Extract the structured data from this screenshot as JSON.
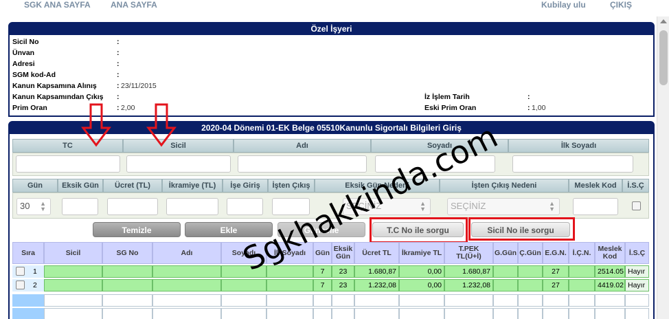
{
  "topnav": {
    "home_sgk": "SGK ANA SAYFA",
    "home": "ANA SAYFA",
    "user": "Kubilay ulu",
    "logout": "ÇIKIŞ"
  },
  "employer": {
    "title": "Özel İşyeri",
    "fields": [
      {
        "label": "Sicil No",
        "value": ""
      },
      {
        "label": "Ünvan",
        "value": ""
      },
      {
        "label": "Adresi",
        "value": ""
      },
      {
        "label": "SGM kod-Ad",
        "value": ""
      },
      {
        "label": "Kanun Kapsamına Alınış",
        "value": "23/11/2015"
      },
      {
        "label": "Kanun Kapsamından Çıkış",
        "value": ""
      },
      {
        "label": "Prim Oran",
        "value": "2,00"
      }
    ],
    "right_fields": [
      {
        "label": "İz İşlem Tarih",
        "value": ""
      },
      {
        "label": "Eski Prim Oran",
        "value": "1,00"
      }
    ]
  },
  "insured": {
    "title": "2020-04 Dönemi 01-EK Belge 05510Kanunlu Sigortalı Bilgileri Giriş",
    "filters_row1": [
      "TC",
      "Sicil",
      "Adı",
      "Soyadı",
      "İlk Soyadı"
    ],
    "filters_row2": [
      "Gün",
      "Eksik Gün",
      "Ücret (TL)",
      "İkramiye (TL)",
      "İşe Giriş",
      "İşten Çıkış",
      "Eksik Gün Nedeni",
      "İşten Çıkış Nedeni",
      "Meslek Kod",
      "İ.S.Ç"
    ],
    "gun_value": "30",
    "select_placeholder_1": "SEÇİNİZ",
    "select_placeholder_2": "SEÇİNİZ",
    "buttons": {
      "clear": "Temizle",
      "add": "Ekle",
      "update": "Güncelle",
      "tc_query": "T.C No ile sorgu",
      "sicil_query": "Sicil No ile sorgu"
    },
    "grid_headers": [
      "Sıra",
      "Sicil",
      "SG No",
      "Adı",
      "Soyadı",
      "İlkSoyadı",
      "Gün",
      "Eksik Gün",
      "Ücret TL",
      "İkramiye TL",
      "T.PEK TL(Ü+İ)",
      "G.Gün",
      "Ç.Gün",
      "E.G.N.",
      "İ.Ç.N.",
      "Meslek Kod",
      "İ.S.Ç"
    ],
    "rows": [
      {
        "sira": "1",
        "sicil": "",
        "sgno": "",
        "adi": "",
        "soyadi": "",
        "ilksoyadi": "",
        "gun": "7",
        "eksik": "23",
        "ucret": "1.680,87",
        "ikramiye": "0,00",
        "tpek": "1.680,87",
        "ggun": "",
        "cgun": "",
        "egn": "27",
        "icn": "",
        "meslek": "2514.05",
        "isc": "Hayır"
      },
      {
        "sira": "2",
        "sicil": "",
        "sgno": "",
        "adi": "",
        "soyadi": "",
        "ilksoyadi": "",
        "gun": "7",
        "eksik": "23",
        "ucret": "1.232,08",
        "ikramiye": "0,00",
        "tpek": "1.232,08",
        "ggun": "",
        "cgun": "",
        "egn": "27",
        "icn": "",
        "meslek": "4419.02",
        "isc": "Hayır"
      }
    ]
  },
  "watermark": "Sgkhakkinda.com",
  "colors": {
    "panel_header": "#0a1f66",
    "grid_row": "#a8f0a0",
    "highlight": "#e3141c",
    "grid_header": "#d0d4ff"
  }
}
